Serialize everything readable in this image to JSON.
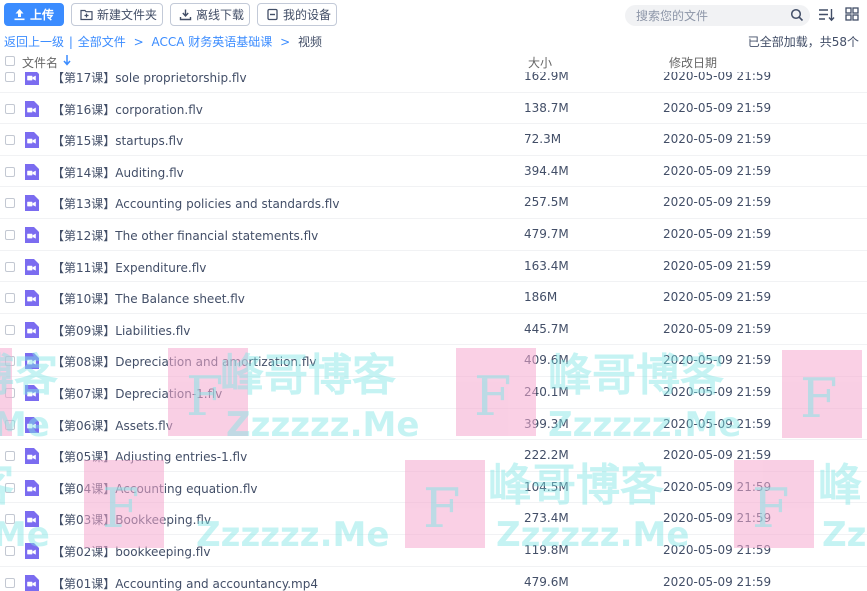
{
  "toolbar": {
    "upload_label": "上传",
    "new_folder_label": "新建文件夹",
    "offline_download_label": "离线下载",
    "my_devices_label": "我的设备"
  },
  "search": {
    "placeholder": "搜索您的文件"
  },
  "breadcrumb": {
    "back": "返回上一级",
    "sep_bar": "|",
    "all_files": "全部文件",
    "parent": "ACCA 财务英语基础课",
    "current": "视频",
    "arrow": ">"
  },
  "status": {
    "loaded_text": "已全部加载，共58个"
  },
  "columns": {
    "name": "文件名",
    "size": "大小",
    "modified": "修改日期",
    "sort_icon": "arrow-down-icon"
  },
  "colors": {
    "accent": "#3b8cff",
    "video_icon": "#7b6cf0",
    "text": "#424e67",
    "watermark_pink": "#f5a9cf",
    "watermark_cyan": "#7fe6e6"
  },
  "files": [
    {
      "name": "【第17课】sole proprietorship.flv",
      "size": "162.9M",
      "date": "2020-05-09 21:59"
    },
    {
      "name": "【第16课】corporation.flv",
      "size": "138.7M",
      "date": "2020-05-09 21:59"
    },
    {
      "name": "【第15课】startups.flv",
      "size": "72.3M",
      "date": "2020-05-09 21:59"
    },
    {
      "name": "【第14课】Auditing.flv",
      "size": "394.4M",
      "date": "2020-05-09 21:59"
    },
    {
      "name": "【第13课】Accounting policies and standards.flv",
      "size": "257.5M",
      "date": "2020-05-09 21:59"
    },
    {
      "name": "【第12课】The other financial statements.flv",
      "size": "479.7M",
      "date": "2020-05-09 21:59"
    },
    {
      "name": "【第11课】Expenditure.flv",
      "size": "163.4M",
      "date": "2020-05-09 21:59"
    },
    {
      "name": "【第10课】The Balance sheet.flv",
      "size": "186M",
      "date": "2020-05-09 21:59"
    },
    {
      "name": "【第09课】Liabilities.flv",
      "size": "445.7M",
      "date": "2020-05-09 21:59"
    },
    {
      "name": "【第08课】Depreciation and amortization.flv",
      "size": "409.6M",
      "date": "2020-05-09 21:59"
    },
    {
      "name": "【第07课】Depreciation-1.flv",
      "size": "240.1M",
      "date": "2020-05-09 21:59"
    },
    {
      "name": "【第06课】Assets.flv",
      "size": "399.3M",
      "date": "2020-05-09 21:59"
    },
    {
      "name": "【第05课】Adjusting entries-1.flv",
      "size": "222.2M",
      "date": "2020-05-09 21:59"
    },
    {
      "name": "【第04课】Accounting equation.flv",
      "size": "104.5M",
      "date": "2020-05-09 21:59"
    },
    {
      "name": "【第03课】Bookkeeping.flv",
      "size": "273.4M",
      "date": "2020-05-09 21:59"
    },
    {
      "name": "【第02课】bookkeeping.flv",
      "size": "119.8M",
      "date": "2020-05-09 21:59"
    },
    {
      "name": "【第01课】Accounting and accountancy.mp4",
      "size": "479.6M",
      "date": "2020-05-09 21:59"
    }
  ],
  "watermark": {
    "brand": "峰哥博客",
    "url": "Zzzzzz.Me",
    "letter": "F"
  }
}
